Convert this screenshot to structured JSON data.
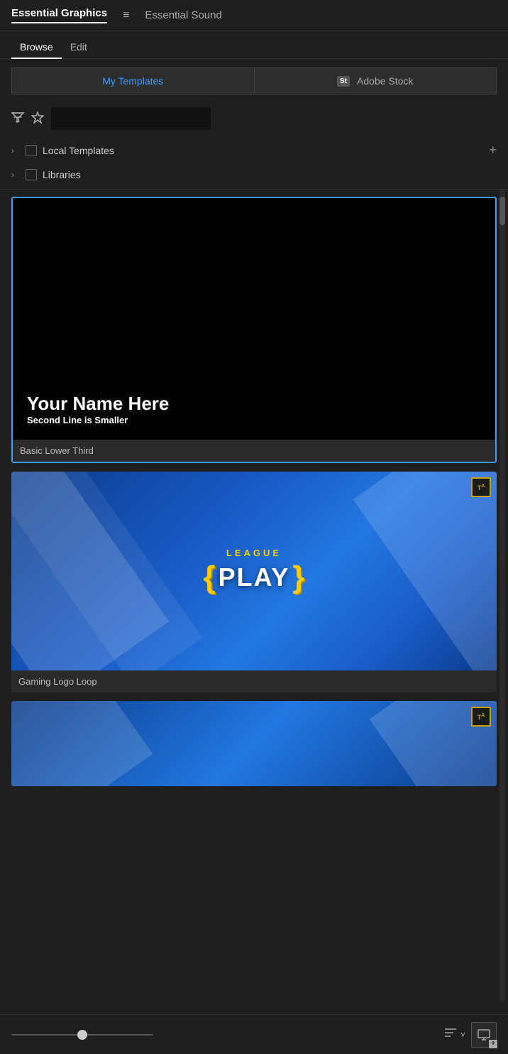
{
  "topNav": {
    "title": "Essential Graphics",
    "menuIcon": "≡",
    "secondary": "Essential Sound"
  },
  "tabs": [
    {
      "label": "Browse",
      "active": true
    },
    {
      "label": "Edit",
      "active": false
    }
  ],
  "toggleButtons": [
    {
      "label": "My Templates",
      "active": true
    },
    {
      "label": "Adobe Stock",
      "active": false,
      "stockIcon": "St"
    }
  ],
  "search": {
    "placeholder": ""
  },
  "folderRows": [
    {
      "label": "Local Templates",
      "hasAdd": true
    },
    {
      "label": "Libraries",
      "hasAdd": false
    }
  ],
  "templates": [
    {
      "name": "Basic Lower Third",
      "selected": true,
      "type": "basic",
      "previewText": "Your Name Here",
      "previewSub": "Second Line is Smaller"
    },
    {
      "name": "Gaming Logo Loop",
      "selected": false,
      "type": "gaming",
      "leagueText": "LEAGUE",
      "playText": "PLAY",
      "hasTABadge": true
    },
    {
      "name": "",
      "selected": false,
      "type": "third",
      "hasTABadge": true
    }
  ],
  "bottomBar": {
    "sortLabel": "Sort",
    "newItemTooltip": "New Item",
    "plusIcon": "+",
    "chevronDown": "˅"
  }
}
